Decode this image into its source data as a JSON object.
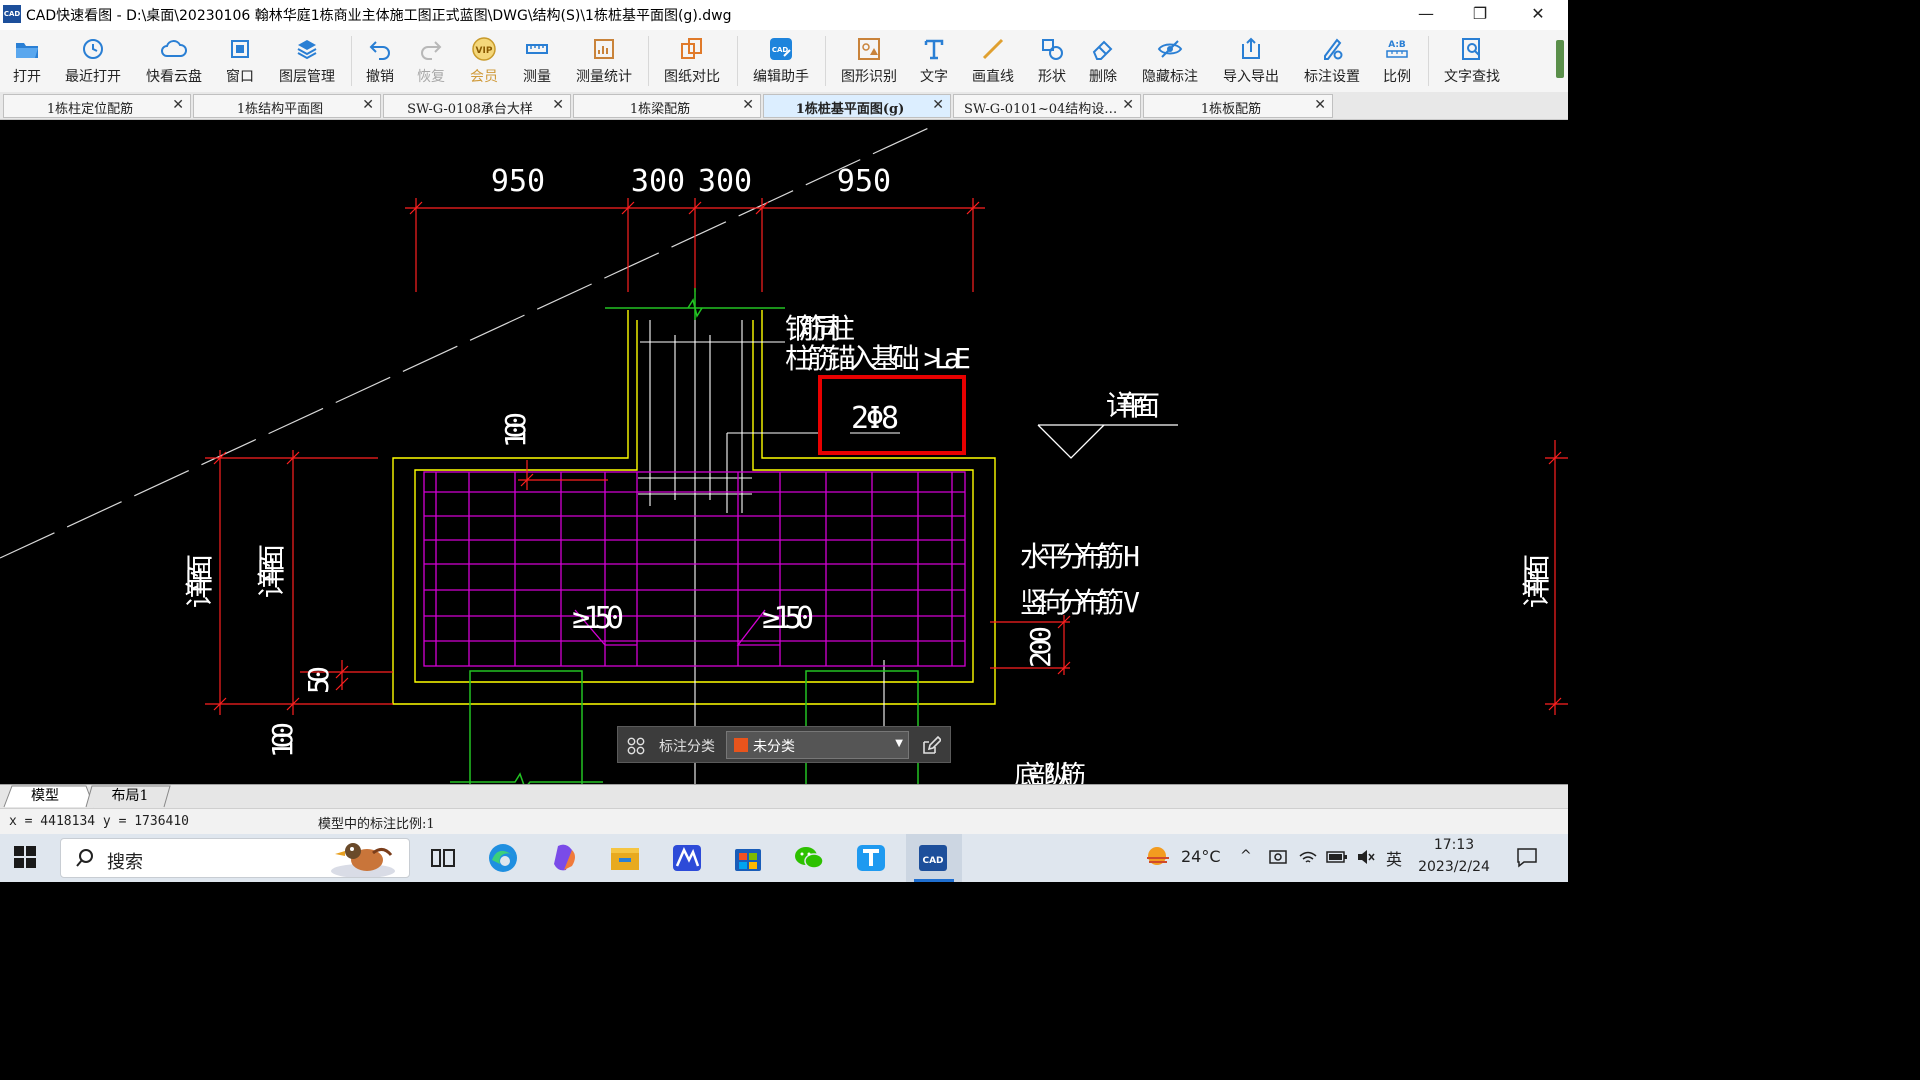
{
  "window": {
    "title": "CAD快速看图 - D:\\桌面\\20230106 翰林华庭1栋商业主体施工图正式蓝图\\DWG\\结构(S)\\1栋桩基平面图(g).dwg",
    "logo_text": "CAD",
    "controls": {
      "minimize": "—",
      "restore": "❐",
      "close": "✕"
    }
  },
  "toolbar": {
    "items": [
      {
        "label": "打开",
        "icon": "open-folder-icon"
      },
      {
        "label": "最近打开",
        "icon": "recent-clock-icon"
      },
      {
        "label": "快看云盘",
        "icon": "cloud-icon"
      },
      {
        "label": "窗口",
        "icon": "window-select-icon"
      },
      {
        "label": "图层管理",
        "icon": "layers-icon"
      },
      {
        "label": "撤销",
        "icon": "undo-icon"
      },
      {
        "label": "恢复",
        "icon": "redo-icon",
        "disabled": true
      },
      {
        "label": "会员",
        "icon": "vip-badge-icon",
        "badge_text": "VIP",
        "disabled": true
      },
      {
        "label": "测量",
        "icon": "ruler-icon"
      },
      {
        "label": "测量统计",
        "icon": "measure-stats-icon"
      },
      {
        "label": "图纸对比",
        "icon": "compare-icon"
      },
      {
        "label": "编辑助手",
        "icon": "edit-assistant-icon",
        "badge_text": "CAD"
      },
      {
        "label": "图形识别",
        "icon": "shape-recognize-icon"
      },
      {
        "label": "文字",
        "icon": "text-icon"
      },
      {
        "label": "画直线",
        "icon": "line-icon"
      },
      {
        "label": "形状",
        "icon": "shapes-icon"
      },
      {
        "label": "删除",
        "icon": "eraser-icon"
      },
      {
        "label": "隐藏标注",
        "icon": "hide-eye-icon"
      },
      {
        "label": "导入导出",
        "icon": "import-export-icon"
      },
      {
        "label": "标注设置",
        "icon": "annotation-settings-icon"
      },
      {
        "label": "比例",
        "icon": "scale-ab-icon",
        "badge_text": "A:B"
      },
      {
        "label": "文字查找",
        "icon": "text-search-icon"
      }
    ]
  },
  "tabs": [
    {
      "label": "1栋柱定位配筋",
      "active": false
    },
    {
      "label": "1栋结构平面图",
      "active": false
    },
    {
      "label": "SW-G-0108承台大样",
      "active": false
    },
    {
      "label": "1栋梁配筋",
      "active": false
    },
    {
      "label": "1栋桩基平面图(g)",
      "active": true
    },
    {
      "label": "SW-G-0101~04结构设…",
      "active": false
    },
    {
      "label": "1栋板配筋",
      "active": false
    }
  ],
  "tab_close_glyph": "✕",
  "drawing": {
    "dimensions": [
      "950",
      "300",
      "300",
      "950"
    ],
    "notes": {
      "rebar_same_column": "钢筋同柱",
      "column_anchor": "柱筋锚入基础 >LaE",
      "stirrup": "2Φ8",
      "detail_plan_right": "详平面",
      "detail_plan_left_1": "详平面",
      "detail_plan_left_2": "详平面",
      "detail_plan_far_right": "详平面",
      "horizontal_bars": "水平分布筋 H",
      "vertical_bars": "竖向分布筋 V",
      "bottom_bars": "底部纵筋",
      "min_spacing_1": "≥150",
      "min_spacing_2": "≥150",
      "dim_100_top": "100",
      "dim_50": "50",
      "dim_100_bottom": "100",
      "dim_200": "200"
    },
    "colors": {
      "dimension": "#ff2020",
      "column": "#ffff00",
      "mesh": "#d400d4",
      "green": "#22c322",
      "text": "#ffffff",
      "highlight": "#e80000"
    }
  },
  "annotation_bar": {
    "label": "标注分类",
    "selected": "未分类",
    "swatch_color": "#e8541c"
  },
  "layout_tabs": [
    {
      "label": "模型",
      "active": true
    },
    {
      "label": "布局1",
      "active": false
    }
  ],
  "status": {
    "coords": "x = 4418134  y = 1736410",
    "scale": "模型中的标注比例:1"
  },
  "taskbar": {
    "search_text": "搜索",
    "apps": [
      "task-view-icon",
      "edge-icon",
      "copilot-icon",
      "file-explorer-icon",
      "maxthon-icon",
      "store-icon",
      "wechat-icon",
      "text-app-icon",
      "cad-app-icon"
    ],
    "temperature": "24°C",
    "ime": "英",
    "time": "17:13",
    "date": "2023/2/24"
  }
}
